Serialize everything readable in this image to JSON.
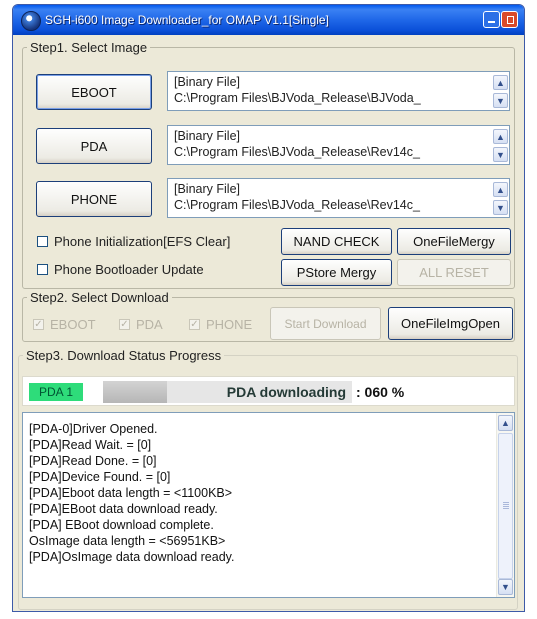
{
  "window": {
    "title": "SGH-i600 Image Downloader_for OMAP V1.1[Single]"
  },
  "step1": {
    "legend": "Step1. Select Image",
    "buttons": [
      {
        "label": "EBOOT"
      },
      {
        "label": "PDA"
      },
      {
        "label": "PHONE"
      }
    ],
    "files": [
      {
        "line1": "[Binary File]",
        "line2": "C:\\Program Files\\BJVoda_Release\\BJVoda_"
      },
      {
        "line1": "[Binary File]",
        "line2": "C:\\Program Files\\BJVoda_Release\\Rev14c_"
      },
      {
        "line1": "[Binary File]",
        "line2": "C:\\Program Files\\BJVoda_Release\\Rev14c_"
      }
    ],
    "phone_init_label": "Phone Initialization[EFS Clear]",
    "phone_boot_label": "Phone Bootloader Update",
    "nand_check_label": "NAND CHECK",
    "onefile_mergy_label": "OneFileMergy",
    "pstore_mergy_label": "PStore Mergy",
    "all_reset_label": "ALL RESET"
  },
  "step2": {
    "legend": "Step2. Select Download",
    "eboot_label": "EBOOT",
    "pda_label": "PDA",
    "phone_label": "PHONE",
    "start_download_label": "Start Download",
    "onefile_img_open_label": "OneFileImgOpen"
  },
  "step3": {
    "legend": "Step3. Download Status Progress",
    "badge": "PDA 1",
    "progress_text": "PDA downloading",
    "progress_suffix": ": 060 %",
    "progress_percent": 60
  },
  "log": {
    "lines": [
      "[PDA-0]Driver Opened.",
      "[PDA]Read Wait. = [0]",
      "[PDA]Read Done. = [0]",
      "[PDA]Device Found. = [0]",
      "[PDA]Eboot data length = <1100KB>",
      "[PDA]EBoot data download ready.",
      "[PDA] EBoot download complete.",
      "OsImage data length = <56951KB>",
      "[PDA]OsImage data download ready."
    ]
  },
  "colors": {
    "titlebar": "#0a4fd8",
    "badge_green": "#2edc7a",
    "progress_fill": "#c0c0c0",
    "dialog_bg": "#ece9d8"
  },
  "icons": [
    "app-logo-icon",
    "minimize-icon",
    "close-icon",
    "spin-up-icon",
    "spin-down-icon",
    "scroll-up-icon",
    "scroll-down-icon",
    "checkmark-icon"
  ]
}
